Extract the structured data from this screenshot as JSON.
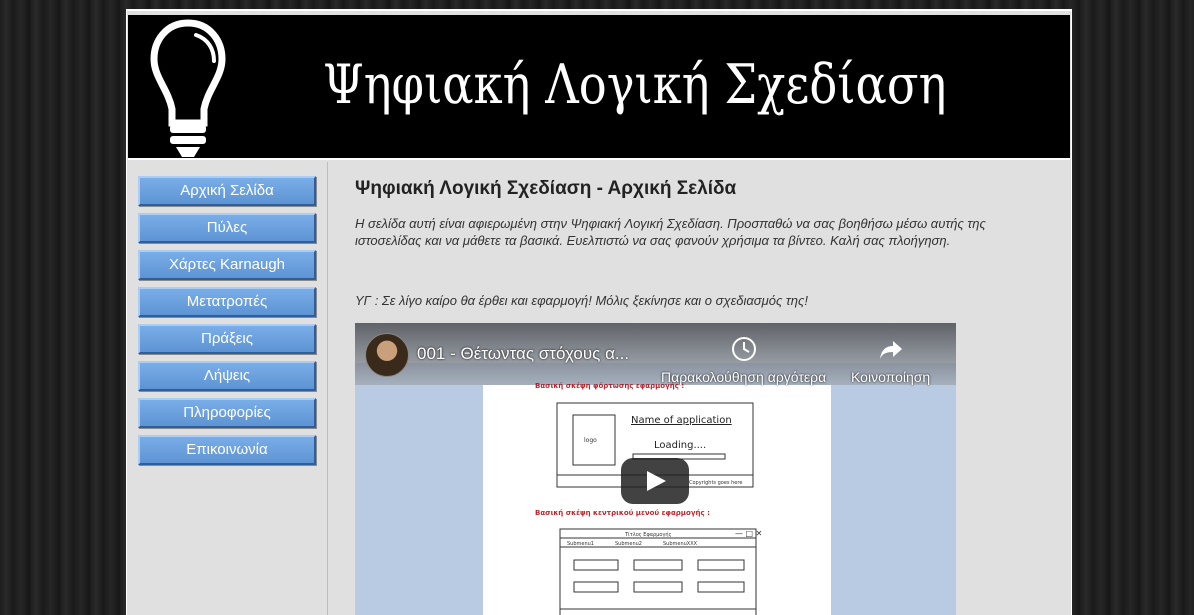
{
  "header": {
    "site_title": "Ψηφιακή Λογική Σχεδίαση",
    "logo_icon": "lightbulb-icon"
  },
  "sidebar": {
    "items": [
      {
        "label": "Αρχική Σελίδα"
      },
      {
        "label": "Πύλες"
      },
      {
        "label": "Χάρτες Karnaugh"
      },
      {
        "label": "Μετατροπές"
      },
      {
        "label": "Πράξεις"
      },
      {
        "label": "Λήψεις"
      },
      {
        "label": "Πληροφορίες"
      },
      {
        "label": "Επικοινωνία"
      }
    ]
  },
  "main": {
    "heading": "Ψηφιακή Λογική Σχεδίαση - Αρχική Σελίδα",
    "intro_line1": "Η σελίδα αυτή είναι αφιερωμένη στην Ψηφιακή Λογική Σχεδίαση. Προσπαθώ να σας βοηθήσω μέσω αυτής της",
    "intro_line2": "ιστοσελίδας και να μάθετε τα βασικά. Ευελπιστώ να σας φανούν χρήσιμα τα βίντεο. Καλή σας πλοήγηση.",
    "ps": "ΥΓ : Σε λίγο καίρο θα έρθει και εφαρμογή! Μόλις ξεκίνησε και ο σχεδιασμός της!"
  },
  "video": {
    "title": "001 - Θέτωντας στόχους α...",
    "watch_later": "Παρακολούθηση αργότερα",
    "share": "Κοινοποίηση",
    "slide_header_1": "Βασική σκέψη φόρτωσης εφαρμογής :",
    "slide_app_name": "Name of application",
    "slide_loading": "Loading....",
    "slide_logo": "logo",
    "slide_copyrights": "Copyrights goes here",
    "slide_header_2": "Βασική σκέψη κεντρικού μενού εφαρμογής :",
    "slide_app_title": "Τίτλος Εφαρμογής",
    "slide_submenu1": "Submenu1",
    "slide_submenu2": "Submenu2",
    "slide_submenu3": "SubmenuXXX"
  },
  "colors": {
    "nav_button": "#6ba2e0",
    "header_bg": "#000000",
    "page_bg": "#e0e0e0"
  }
}
